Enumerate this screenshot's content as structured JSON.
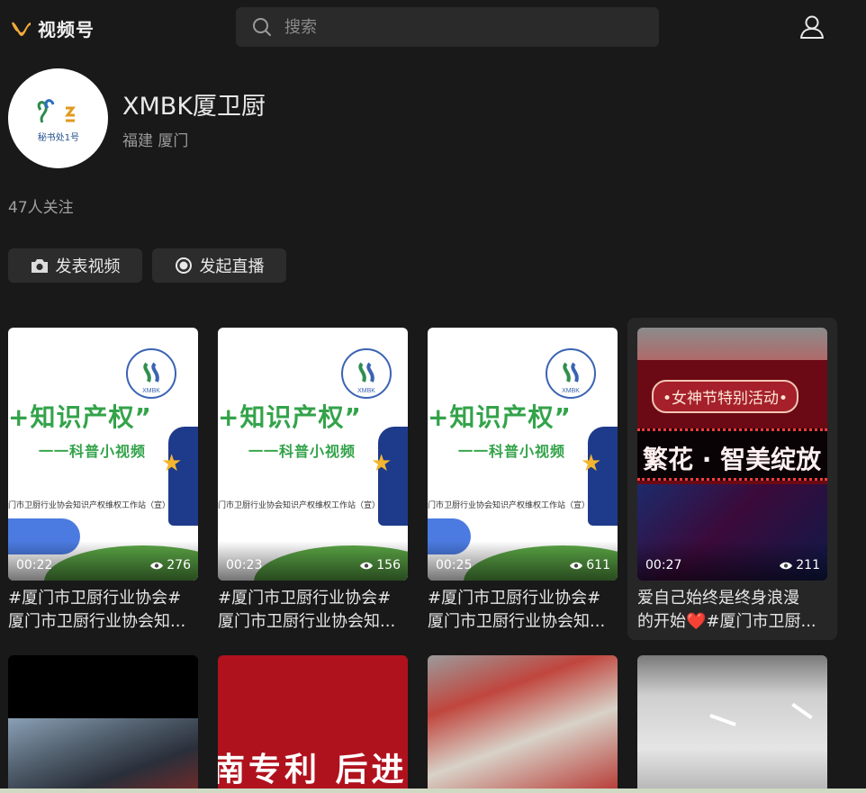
{
  "app": {
    "title": "视频号",
    "accent": "#f2a93b"
  },
  "search": {
    "placeholder": "搜索"
  },
  "profile": {
    "name": "XMBK厦卫厨",
    "location": "福建 厦门",
    "avatar_caption": "秘书处1号",
    "followers": "47人关注"
  },
  "actions": {
    "post_video": "发表视频",
    "start_live": "发起直播"
  },
  "knowledge_card": {
    "headline": "+知识产权”",
    "subtitle": "一一科普小视频",
    "station": "门市卫厨行业协会知识产权维权工作站（宣）",
    "badge_text": "XMBK"
  },
  "videos": [
    {
      "duration": "00:22",
      "views": "276",
      "caption_line1": "#厦门市卫厨行业协会#",
      "caption_line2": "厦门市卫厨行业协会知..."
    },
    {
      "duration": "00:23",
      "views": "156",
      "caption_line1": "#厦门市卫厨行业协会#",
      "caption_line2": "厦门市卫厨行业协会知..."
    },
    {
      "duration": "00:25",
      "views": "611",
      "caption_line1": "#厦门市卫厨行业协会#",
      "caption_line2": "厦门市卫厨行业协会知..."
    },
    {
      "duration": "00:27",
      "views": "211",
      "caption_line1": "爱自己始终是终身浪漫",
      "caption_line2": "的开始❤️#厦门市卫厨...",
      "banner": "•女神节特别活动•",
      "sign": "繁花 · 智美绽放"
    }
  ],
  "row2": {
    "patent_text": "南专利  后进"
  }
}
